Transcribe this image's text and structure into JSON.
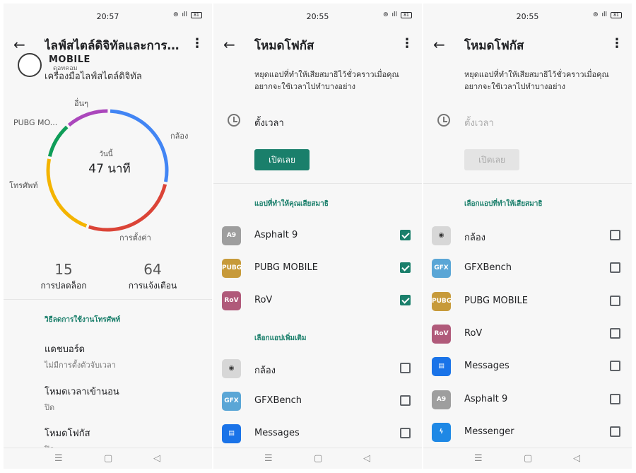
{
  "status": {
    "p1_time": "20:57",
    "p2_time": "20:55",
    "p3_time": "20:55",
    "wifi": "⊜",
    "signal": "ıll",
    "battery": "81"
  },
  "screen1": {
    "title": "ไลฟ์สไตล์ดิจิทัลและการค...",
    "watermark_top": "MOBILE",
    "watermark_bottom": "ดอทคอม",
    "subtitle": "เครื่องมือไลฟ์สไตล์ดิจิทัล",
    "chart_data": {
      "type": "pie",
      "center_caption": "วันนี้",
      "center_value": "47 นาที",
      "labels": [
        "กล้อง",
        "การตั้งค่า",
        "โทรศัพท์",
        "PUBG MO...",
        "อื่นๆ"
      ],
      "values": [
        28,
        27,
        23,
        10,
        12
      ],
      "colors": [
        "#4285f4",
        "#db4437",
        "#f4b400",
        "#0f9d58",
        "#ab47bc"
      ]
    },
    "stats": [
      {
        "value": "15",
        "label": "การปลดล็อก"
      },
      {
        "value": "64",
        "label": "การแจ้งเตือน"
      }
    ],
    "section_title": "วิธีลดการใช้งานโทรศัพท์",
    "items": [
      {
        "title": "แดชบอร์ด",
        "subtitle": "ไม่มีการตั้งตัวจับเวลา"
      },
      {
        "title": "โหมดเวลาเข้านอน",
        "subtitle": "ปิด"
      },
      {
        "title": "โหมดโฟกัส",
        "subtitle": "ปิด"
      }
    ]
  },
  "screen2": {
    "title": "โหมดโฟกัส",
    "description": "หยุดแอปที่ทำให้เสียสมาธิไว้ชั่วคราวเมื่อคุณอยากจะใช้เวลาไปทำบางอย่าง",
    "timer_label": "ตั้งเวลา",
    "button_label": "เปิดเลย",
    "section1": "แอปที่ทำให้คุณเสียสมาธิ",
    "apps1": [
      {
        "name": "Asphalt 9",
        "icon": "asphalt-icon",
        "color": "#9e9e9e",
        "abbr": "A9",
        "checked": true
      },
      {
        "name": "PUBG MOBILE",
        "icon": "pubg-icon",
        "color": "#c79a3a",
        "abbr": "PUBG",
        "checked": true
      },
      {
        "name": "RoV",
        "icon": "rov-icon",
        "color": "#b05a7a",
        "abbr": "RoV",
        "checked": true
      }
    ],
    "section2": "เลือกแอปเพิ่มเติม",
    "apps2": [
      {
        "name": "กล้อง",
        "icon": "camera-icon",
        "color": "#d7d7d7",
        "abbr": "◉",
        "checked": false
      },
      {
        "name": "GFXBench",
        "icon": "gfxbench-icon",
        "color": "#5aa6d6",
        "abbr": "GFX",
        "checked": false
      },
      {
        "name": "Messages",
        "icon": "messages-icon",
        "color": "#1a73e8",
        "abbr": "▤",
        "checked": false
      }
    ]
  },
  "screen3": {
    "title": "โหมดโฟกัส",
    "description": "หยุดแอปที่ทำให้เสียสมาธิไว้ชั่วคราวเมื่อคุณอยากจะใช้เวลาไปทำบางอย่าง",
    "timer_label": "ตั้งเวลา",
    "button_label": "เปิดเลย",
    "section": "เลือกแอปที่ทำให้เสียสมาธิ",
    "apps": [
      {
        "name": "กล้อง",
        "icon": "camera-icon",
        "color": "#d7d7d7",
        "abbr": "◉",
        "checked": false
      },
      {
        "name": "GFXBench",
        "icon": "gfxbench-icon",
        "color": "#5aa6d6",
        "abbr": "GFX",
        "checked": false
      },
      {
        "name": "PUBG MOBILE",
        "icon": "pubg-icon",
        "color": "#c79a3a",
        "abbr": "PUBG",
        "checked": false
      },
      {
        "name": "RoV",
        "icon": "rov-icon",
        "color": "#b05a7a",
        "abbr": "RoV",
        "checked": false
      },
      {
        "name": "Messages",
        "icon": "messages-icon",
        "color": "#1a73e8",
        "abbr": "▤",
        "checked": false
      },
      {
        "name": "Asphalt 9",
        "icon": "asphalt-icon",
        "color": "#9e9e9e",
        "abbr": "A9",
        "checked": false
      },
      {
        "name": "Messenger",
        "icon": "messenger-icon",
        "color": "#1e88e5",
        "abbr": "ϟ",
        "checked": false
      }
    ]
  },
  "nav": {
    "menu": "☰",
    "home": "▢",
    "back": "◁"
  }
}
